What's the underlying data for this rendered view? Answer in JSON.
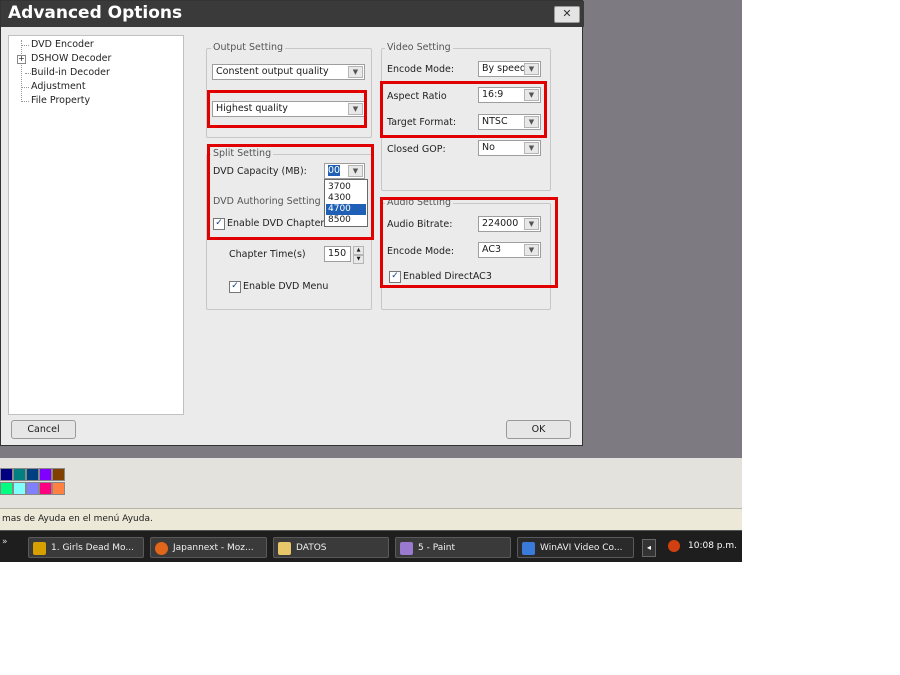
{
  "dialog": {
    "title": "Advanced Options",
    "close_symbol": "✕",
    "tree": [
      "DVD Encoder",
      "DSHOW Decoder",
      "Build-in Decoder",
      "Adjustment",
      "File Property"
    ],
    "output": {
      "group_label": "Output Setting",
      "mode": "Constent output quality",
      "quality": "Highest quality"
    },
    "split": {
      "group_label": "Split Setting",
      "capacity_label": "DVD Capacity (MB):",
      "capacity_value": "00",
      "capacity_options": [
        "3700",
        "4300",
        "4700",
        "8500"
      ],
      "selected_option": "4700"
    },
    "authoring": {
      "group_label": "DVD Authoring Setting",
      "chapter_label": "Enable DVD Chapter",
      "chapter_checked": true,
      "chapter_time_label": "Chapter Time(s)",
      "chapter_time_value": "150",
      "menu_label": "Enable DVD Menu",
      "menu_checked": true
    },
    "video": {
      "group_label": "Video Setting",
      "encode_mode_label": "Encode Mode:",
      "encode_mode_value": "By speed",
      "aspect_label": "Aspect Ratio",
      "aspect_value": "16:9",
      "format_label": "Target Format:",
      "format_value": "NTSC",
      "gop_label": "Closed GOP:",
      "gop_value": "No"
    },
    "audio": {
      "group_label": "Audio Setting",
      "bitrate_label": "Audio Bitrate:",
      "bitrate_value": "224000",
      "encode_mode_label": "Encode Mode:",
      "encode_mode_value": "AC3",
      "direct_label": "Enabled DirectAC3",
      "direct_checked": true
    },
    "cancel_label": "Cancel",
    "ok_label": "OK"
  },
  "status_bar": {
    "text": "mas de Ayuda en el menú Ayuda."
  },
  "palette": {
    "row1": [
      "#000080",
      "#008080",
      "#004080",
      "#8000ff",
      "#804000"
    ],
    "row2": [
      "#00ff80",
      "#80ffff",
      "#8080ff",
      "#ff0080",
      "#ff8040"
    ]
  },
  "taskbar": {
    "tasks": [
      {
        "label": "1. Girls Dead Mo...",
        "icon": "winamp-icon"
      },
      {
        "label": "Japannext - Moz...",
        "icon": "firefox-icon"
      },
      {
        "label": "DATOS",
        "icon": "folder-icon"
      },
      {
        "label": "5 - Paint",
        "icon": "paint-icon"
      },
      {
        "label": "WinAVI Video Co...",
        "icon": "winavi-icon"
      }
    ],
    "clock": "10:08 p.m."
  }
}
